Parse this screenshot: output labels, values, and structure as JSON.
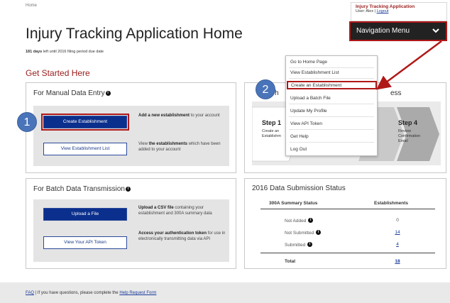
{
  "header": {
    "breadcrumb": "Home",
    "title": "Injury Tracking Application Home",
    "deadline_days": "181 days",
    "deadline_rest": " left until 2016 filing period due date",
    "get_started": "Get Started Here"
  },
  "user_panel": {
    "app_name": "Injury Tracking Application",
    "user_label": "User: Alex",
    "separator": " | ",
    "logout": "Logout"
  },
  "nav": {
    "menu_label": "Navigation Menu",
    "items": [
      "Go to Home Page",
      "View Establishment List",
      "Create an Establishment",
      "Upload a Batch File",
      "Update My Profile",
      "View API Token",
      "Get Help",
      "Log Out"
    ],
    "highlighted_index": 2
  },
  "manual": {
    "title": "For Manual Data Entry",
    "create_button": "Create Establishment",
    "create_help_bold": "Add a new establishment",
    "create_help_rest": " to your account",
    "view_button": "View Establishment List",
    "view_help_pre": "View ",
    "view_help_bold": "the establishments",
    "view_help_rest": " which have been added to your account"
  },
  "batch": {
    "title": "For Batch Data Transmission",
    "upload_button": "Upload a File",
    "upload_help_bold": "Upload a CSV file",
    "upload_help_rest": " containing your establishment and 300A summary data",
    "api_button": "View Your API Token",
    "api_help_bold": "Access your authentication token",
    "api_help_rest": " for use in electronically transmitting data via API"
  },
  "flow": {
    "title_start": "Th",
    "title_end": "ess",
    "step1_head": "Step 1",
    "step1_body": "Create an Establishm",
    "step3_fragment": "a",
    "step4_head": "Step 4",
    "step4_body": "Review Confirmation Email"
  },
  "badges": {
    "one": "1",
    "two": "2"
  },
  "status": {
    "title": "2016 Data Submission Status",
    "col_status": "300A Summary Status",
    "col_est": "Establishments",
    "rows": [
      {
        "label": "Not Added",
        "value": "0"
      },
      {
        "label": "Not Submitted",
        "value": "14"
      },
      {
        "label": "Submitted",
        "value": "4"
      }
    ],
    "total_label": "Total",
    "total_value": "18"
  },
  "footer": {
    "faq": "FAQ",
    "text": " | If you have questions, please complete the ",
    "help_link": "Help Request Form"
  },
  "colors": {
    "accent_red": "#b01818",
    "heading_red": "#9b1c1c",
    "primary_blue": "#0b2f8c",
    "badge_blue": "#4a74b9",
    "nav_dark": "#222222"
  },
  "icons": [
    "info-icon",
    "chevron-down-icon"
  ]
}
